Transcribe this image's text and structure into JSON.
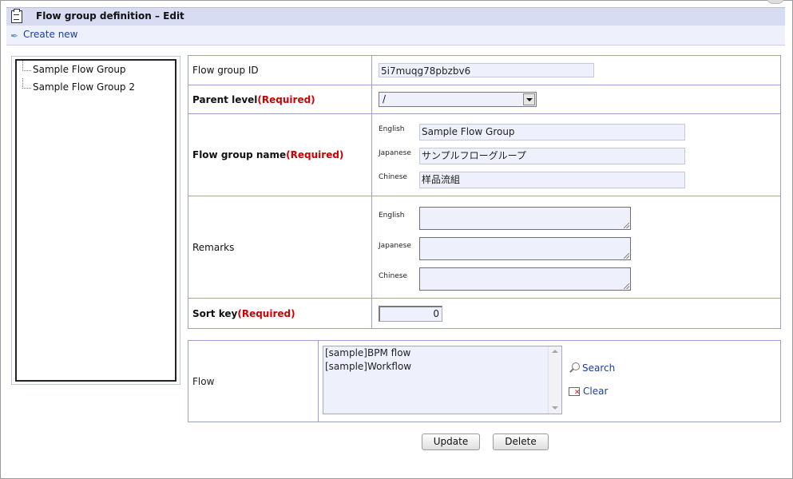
{
  "header": {
    "title": "Flow group definition – Edit",
    "title_icon": "clipboard-icon",
    "create_new_label": "Create new",
    "create_new_icon": "feather-icon"
  },
  "tree": {
    "items": [
      {
        "label": "Sample Flow Group"
      },
      {
        "label": "Sample Flow Group 2"
      }
    ]
  },
  "form": {
    "flow_group_id": {
      "label": "Flow group ID",
      "value": "5i7muqg78pbzbv6"
    },
    "parent_level": {
      "label": "Parent level",
      "required": "(Required)",
      "value": "/"
    },
    "flow_group_name": {
      "label": "Flow group name",
      "required": "(Required)",
      "langs": [
        {
          "lang": "English",
          "value": "Sample Flow Group"
        },
        {
          "lang": "Japanese",
          "value": "サンプルフローグループ"
        },
        {
          "lang": "Chinese",
          "value": "样品流組"
        }
      ]
    },
    "remarks": {
      "label": "Remarks",
      "langs": [
        {
          "lang": "English",
          "value": ""
        },
        {
          "lang": "Japanese",
          "value": ""
        },
        {
          "lang": "Chinese",
          "value": ""
        }
      ]
    },
    "sort_key": {
      "label": "Sort key",
      "required": "(Required)",
      "value": "0"
    }
  },
  "flow": {
    "label": "Flow",
    "items": [
      "[sample]BPM flow",
      "[sample]Workflow"
    ],
    "search_label": "Search",
    "clear_label": "Clear"
  },
  "buttons": {
    "update": "Update",
    "delete": "Delete"
  },
  "colors": {
    "header_bg": "#d8dcf2",
    "required": "#cc0000",
    "link": "#1a3fa0",
    "field_bg": "#eef0fb",
    "border": "#9aa0c8"
  }
}
